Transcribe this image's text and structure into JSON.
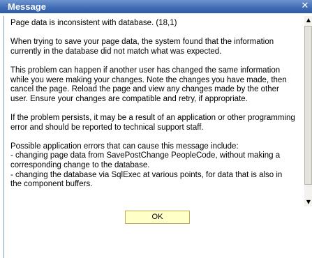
{
  "window": {
    "title": "Message",
    "close_icon": "close-icon"
  },
  "message": {
    "paragraphs": [
      "Page data is inconsistent with database. (18,1)",
      "When trying to save your page data, the system found that the information currently in the database did not match what was expected.",
      "This problem can happen if another user has changed the same information while you were making your changes. Note the changes you have made, then cancel the page.  Reload the page and view any changes made by the other user.  Ensure your changes are compatible and retry, if appropriate.",
      "If the problem persists, it may be a result of an application or other programming error and should be reported to technical support staff."
    ],
    "errors_intro": "Possible application errors that can cause this message include:",
    "error_items": [
      "- changing page data from SavePostChange PeopleCode, without making a corresponding change to the database.",
      "- changing the database via SqlExec at various points, for data that is also in the component buffers."
    ]
  },
  "scrollbar": {
    "up_icon": "scroll-up-arrow-icon",
    "down_icon": "scroll-down-arrow-icon"
  },
  "buttons": {
    "ok_label": "OK"
  },
  "colors": {
    "titlebar": "#3f6bb4",
    "ok_button_bg": "#ffffc8"
  }
}
